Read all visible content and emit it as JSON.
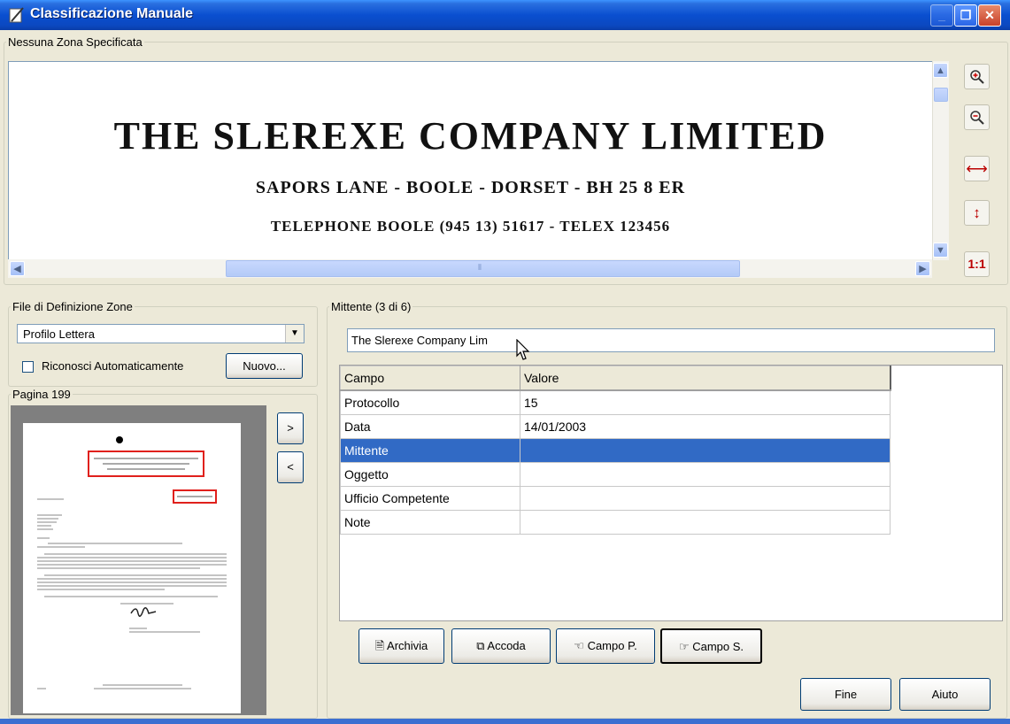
{
  "window": {
    "title": "Classificazione Manuale"
  },
  "viewer": {
    "zone_label": "Nessuna Zona Specificata",
    "document_lines": [
      "THE SLEREXE COMPANY LIMITED",
      "SAPORS LANE - BOOLE - DORSET - BH 25 8 ER",
      "TELEPHONE BOOLE (945 13) 51617 - TELEX 123456"
    ],
    "zoom_buttons": [
      "zoom-in-icon",
      "zoom-out-icon",
      "fit-width-icon",
      "fit-height-icon"
    ],
    "actual_size_label": "1:1"
  },
  "zone_def": {
    "legend": "File di Definizione Zone",
    "profile": "Profilo Lettera",
    "auto_recognize_label": "Riconosci Automaticamente",
    "auto_recognize_checked": false,
    "new_button": "Nuovo..."
  },
  "page_panel": {
    "legend": "Pagina 199",
    "next_button": ">",
    "prev_button": "<"
  },
  "mittente": {
    "legend": "Mittente (3 di 6)",
    "value": "The Slerexe Company Lim"
  },
  "grid": {
    "headers": [
      "Campo",
      "Valore"
    ],
    "rows": [
      {
        "campo": "Protocollo",
        "valore": "15"
      },
      {
        "campo": "Data",
        "valore": "14/01/2003"
      },
      {
        "campo": "Mittente",
        "valore": ""
      },
      {
        "campo": "Oggetto",
        "valore": ""
      },
      {
        "campo": "Ufficio Competente",
        "valore": ""
      },
      {
        "campo": "Note",
        "valore": ""
      }
    ],
    "selected_row": 2
  },
  "actions": {
    "archivia": "Archivia",
    "accoda": "Accoda",
    "campo_p": "Campo P.",
    "campo_s": "Campo S.",
    "fine": "Fine",
    "aiuto": "Aiuto"
  },
  "colors": {
    "titlebar": "#0A4FD0",
    "selection": "#316AC5",
    "highlight_box": "#E0201C"
  }
}
